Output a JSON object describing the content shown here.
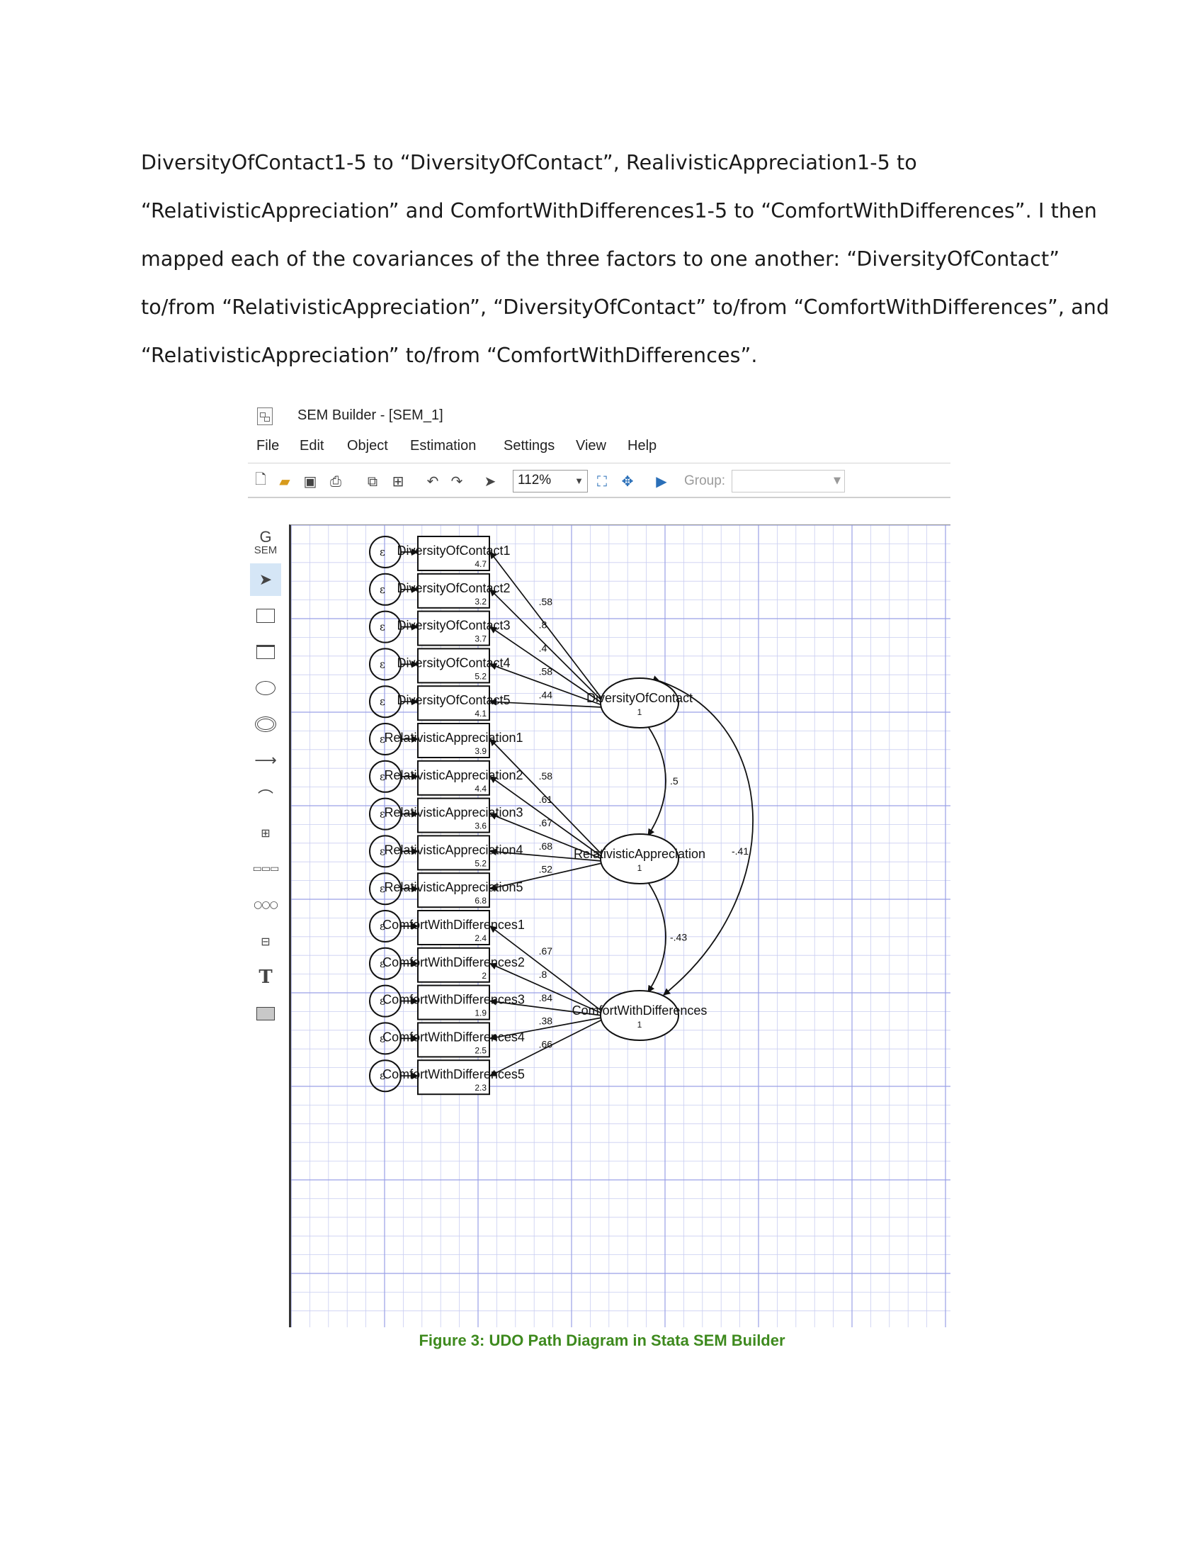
{
  "document": {
    "paragraph_lines": [
      "DiversityOfContact1-5 to “DiversityOfContact”, RealivisticAppreciation1-5 to",
      "“RelativisticAppreciation” and ComfortWithDifferences1-5 to “ComfortWithDifferences”. I then",
      "mapped each of the covariances of the three factors to one another: “DiversityOfContact”",
      "to/from “RelativisticAppreciation”, “DiversityOfContact” to/from “ComfortWithDifferences”, and",
      "“RelativisticAppreciation” to/from “ComfortWithDifferences”."
    ],
    "caption": "Figure 3: UDO Path Diagram in Stata SEM Builder"
  },
  "window": {
    "title": "SEM Builder - [SEM_1]",
    "menu": [
      "File",
      "Edit",
      "Object",
      "Estimation",
      "Settings",
      "View",
      "Help"
    ],
    "zoom": "112%",
    "group_label": "Group:",
    "group_value": ""
  },
  "toolbox": {
    "logo_top": "G",
    "logo_bottom": "SEM"
  },
  "diagram": {
    "error_label": "ε",
    "observed": [
      {
        "name": "DiversityOfContact1",
        "intercept": "4.7",
        "loading": ".58",
        "factor": 0
      },
      {
        "name": "DiversityOfContact2",
        "intercept": "3.2",
        "loading": ".8",
        "factor": 0
      },
      {
        "name": "DiversityOfContact3",
        "intercept": "3.7",
        "loading": ".4",
        "factor": 0
      },
      {
        "name": "DiversityOfContact4",
        "intercept": "5.2",
        "loading": ".58",
        "factor": 0
      },
      {
        "name": "DiversityOfContact5",
        "intercept": "4.1",
        "loading": ".44",
        "factor": 0
      },
      {
        "name": "RelativisticAppreciation1",
        "intercept": "3.9",
        "loading": ".58",
        "factor": 1
      },
      {
        "name": "RelativisticAppreciation2",
        "intercept": "4.4",
        "loading": ".61",
        "factor": 1
      },
      {
        "name": "RelativisticAppreciation3",
        "intercept": "3.6",
        "loading": ".67",
        "factor": 1
      },
      {
        "name": "RelativisticAppreciation4",
        "intercept": "5.2",
        "loading": ".68",
        "factor": 1
      },
      {
        "name": "RelativisticAppreciation5",
        "intercept": "6.8",
        "loading": ".52",
        "factor": 1
      },
      {
        "name": "ComfortWithDifferences1",
        "intercept": "2.4",
        "loading": ".67",
        "factor": 2
      },
      {
        "name": "ComfortWithDifferences2",
        "intercept": "2",
        "loading": ".8",
        "factor": 2
      },
      {
        "name": "ComfortWithDifferences3",
        "intercept": "1.9",
        "loading": ".84",
        "factor": 2
      },
      {
        "name": "ComfortWithDifferences4",
        "intercept": "2.5",
        "loading": ".38",
        "factor": 2
      },
      {
        "name": "ComfortWithDifferences5",
        "intercept": "2.3",
        "loading": ".66",
        "factor": 2
      }
    ],
    "latent": [
      {
        "name": "DiversityOfContact",
        "variance": "1"
      },
      {
        "name": "RelativisticAppreciation",
        "variance": "1"
      },
      {
        "name": "ComfortWithDifferences",
        "variance": "1"
      }
    ],
    "covariances": [
      {
        "from": 0,
        "to": 1,
        "value": ".5"
      },
      {
        "from": 1,
        "to": 2,
        "value": "-.43"
      },
      {
        "from": 0,
        "to": 2,
        "value": "-.41"
      }
    ]
  }
}
